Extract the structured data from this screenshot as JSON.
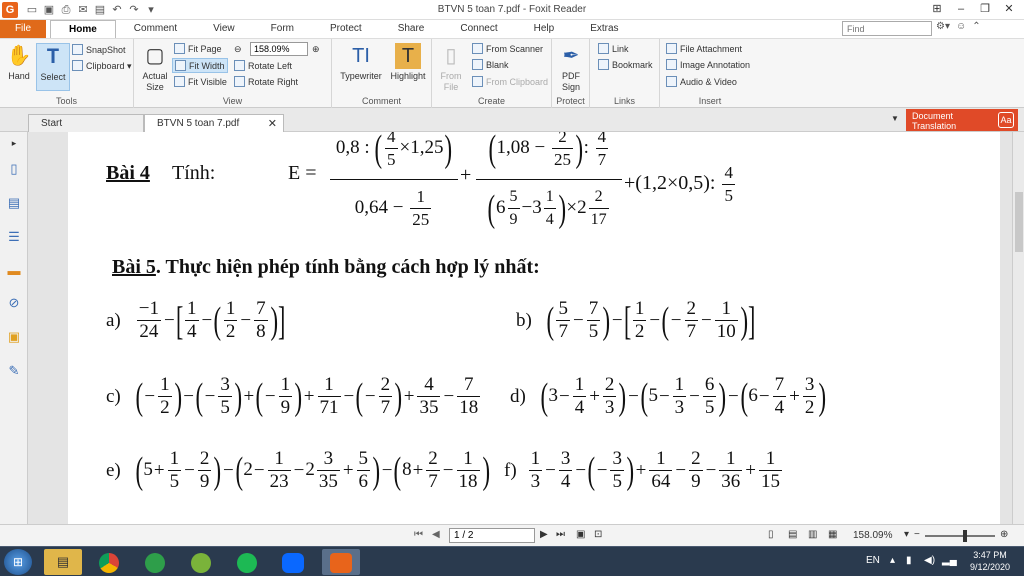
{
  "window": {
    "title": "BTVN 5 toan 7.pdf - Foxit Reader"
  },
  "ribbon_tabs": [
    "File",
    "Home",
    "Comment",
    "View",
    "Form",
    "Protect",
    "Share",
    "Connect",
    "Help",
    "Extras"
  ],
  "search": {
    "placeholder": "Find"
  },
  "ribbon": {
    "tools": {
      "label": "Tools",
      "hand": "Hand",
      "select": "Select",
      "snapshot": "SnapShot",
      "clipboard": "Clipboard"
    },
    "view": {
      "label": "View",
      "actual_size": "Actual Size",
      "fit_page": "Fit Page",
      "fit_width": "Fit Width",
      "fit_visible": "Fit Visible",
      "zoom": "158.09%",
      "rotate_left": "Rotate Left",
      "rotate_right": "Rotate Right"
    },
    "comment": {
      "label": "Comment",
      "typewriter": "Typewriter",
      "highlight": "Highlight"
    },
    "create": {
      "label": "Create",
      "from_file": "From File",
      "from_scanner": "From Scanner",
      "blank": "Blank",
      "from_clipboard": "From Clipboard"
    },
    "protect": {
      "label": "Protect",
      "pdf_sign": "PDF Sign"
    },
    "links": {
      "label": "Links",
      "link": "Link",
      "bookmark": "Bookmark"
    },
    "insert": {
      "label": "Insert",
      "file_attachment": "File Attachment",
      "image_annotation": "Image Annotation",
      "audio_video": "Audio & Video"
    }
  },
  "doc_tabs": {
    "start": "Start",
    "file": "BTVN 5 toan 7.pdf"
  },
  "translation_btn": "Document Translation",
  "doc": {
    "bai4": {
      "title": "Bài 4",
      "label": "Tính:",
      "expr": "E ="
    },
    "bai5": {
      "title": "Bài 5",
      "rest": ". Thực hiện phép tính bằng cách hợp lý nhất:"
    },
    "labels": {
      "a": "a)",
      "b": "b)",
      "c": "c)",
      "d": "d)",
      "e": "e)",
      "f": "f)"
    }
  },
  "status": {
    "page": "1 / 2",
    "zoom": "158.09%"
  },
  "taskbar": {
    "lang": "EN",
    "time": "3:47 PM",
    "date": "9/12/2020"
  }
}
